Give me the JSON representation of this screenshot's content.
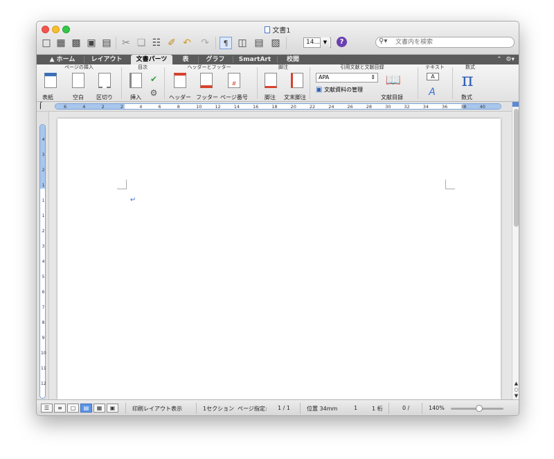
{
  "window": {
    "title": "文書1"
  },
  "toolbar": {
    "icons": [
      "new-icon",
      "template-icon",
      "open-icon",
      "save-icon",
      "print-icon",
      "cut-icon",
      "copy-icon",
      "paste-icon",
      "format-painter-icon",
      "undo-icon",
      "redo-icon",
      "formatting-marks-icon",
      "sidebar-icon",
      "print-layout-icon",
      "media-browser-icon"
    ],
    "zoom_value": "14...",
    "search_placeholder": "文書内を検索"
  },
  "tabs": [
    "ホーム",
    "レイアウト",
    "文書パーツ",
    "表",
    "グラフ",
    "SmartArt",
    "校閲"
  ],
  "active_tab": "文書パーツ",
  "ribbon": {
    "groups": [
      {
        "title": "ページの挿入",
        "buttons": [
          "表紙",
          "空白",
          "区切り"
        ]
      },
      {
        "title": "目次",
        "buttons": [
          "挿入"
        ]
      },
      {
        "title": "ヘッダーとフッター",
        "buttons": [
          "ヘッダー",
          "フッター",
          "ページ番号"
        ]
      },
      {
        "title": "脚注",
        "buttons": [
          "脚注",
          "文末脚注"
        ]
      },
      {
        "title": "引用文献と文献目録",
        "style_value": "APA",
        "manage_label": "文献資料の管理",
        "bibliography_label": "文献目録"
      },
      {
        "title": "テキスト"
      },
      {
        "title": "数式",
        "buttons": [
          "数式"
        ]
      }
    ]
  },
  "ruler_h": [
    "6",
    "4",
    "2",
    "2",
    "4",
    "6",
    "8",
    "10",
    "12",
    "14",
    "16",
    "18",
    "20",
    "22",
    "24",
    "26",
    "28",
    "30",
    "32",
    "34",
    "36",
    "38",
    "40"
  ],
  "ruler_v": [
    "4",
    "3",
    "2",
    "1",
    "1",
    "1",
    "2",
    "3",
    "4",
    "5",
    "6",
    "7",
    "8",
    "9",
    "10",
    "11",
    "12"
  ],
  "statusbar": {
    "view_mode": "印刷レイアウト表示",
    "section": "1セクション",
    "page_label": "ページ指定:",
    "page_value": "1 / 1",
    "position": "位置 34mm",
    "line": "1",
    "column": "1 桁",
    "words": "0 /",
    "zoom": "140%"
  }
}
